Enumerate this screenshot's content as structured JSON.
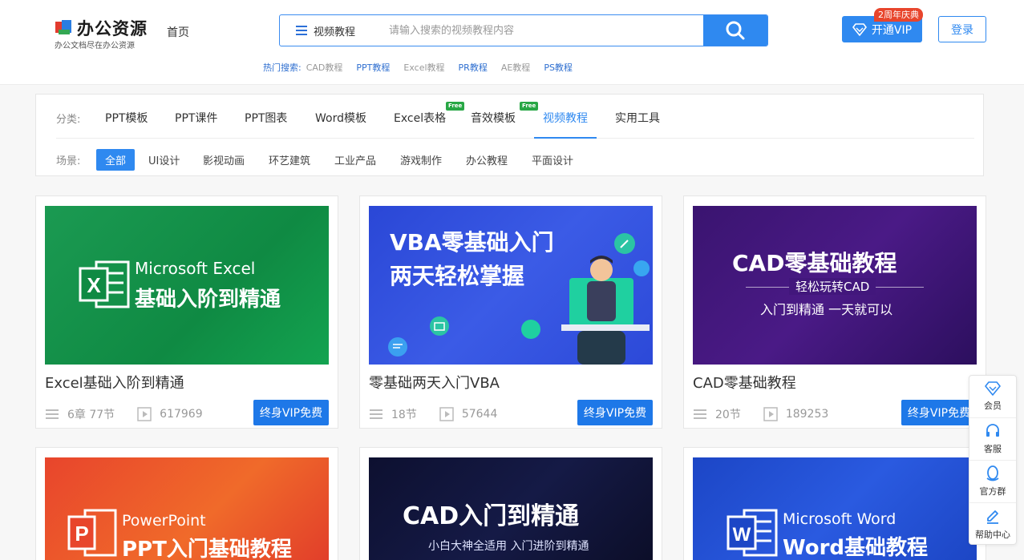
{
  "header": {
    "logo_title": "办公资源",
    "logo_subtitle": "办公文档尽在办公资源",
    "home_label": "首页",
    "search": {
      "category": "视频教程",
      "placeholder": "请输入搜索的视频教程内容"
    },
    "hot_label": "热门搜索:",
    "hot_items": [
      "CAD教程",
      "PPT教程",
      "Excel教程",
      "PR教程",
      "AE教程",
      "PS教程"
    ],
    "vip_label": "开通VIP",
    "vip_badge": "2周年庆典",
    "login_label": "登录"
  },
  "filter": {
    "category_label": "分类:",
    "categories": [
      "PPT模板",
      "PPT课件",
      "PPT图表",
      "Word模板",
      "Excel表格",
      "音效模板",
      "视频教程",
      "实用工具"
    ],
    "free_tag": "Free",
    "scene_label": "场景:",
    "scenes": [
      "全部",
      "UI设计",
      "影视动画",
      "环艺建筑",
      "工业产品",
      "游戏制作",
      "办公教程",
      "平面设计"
    ]
  },
  "cards": [
    {
      "title": "Excel基础入阶到精通",
      "chapters": "6章 77节",
      "views": "617969",
      "button": "终身VIP免费",
      "thumb": {
        "line1": "Microsoft Excel",
        "line2": "基础入阶到精通",
        "letter": "X"
      }
    },
    {
      "title": "零基础两天入门VBA",
      "chapters": "18节",
      "views": "57644",
      "button": "终身VIP免费",
      "thumb": {
        "line1": "VBA零基础入门",
        "line2": "两天轻松掌握"
      }
    },
    {
      "title": "CAD零基础教程",
      "chapters": "20节",
      "views": "189253",
      "button": "终身VIP免费",
      "thumb": {
        "line1": "CAD零基础教程",
        "line2": "轻松玩转CAD",
        "line3": "入门到精通 一天就可以"
      }
    },
    {
      "thumb": {
        "line1": "PowerPoint",
        "line2": "PPT入门基础教程",
        "letter": "P"
      }
    },
    {
      "thumb": {
        "line1": "CAD入门到精通",
        "line2": "小白大神全适用 入门进阶到精通"
      }
    },
    {
      "thumb": {
        "line1": "Microsoft Word",
        "line2": "Word基础教程",
        "letter": "W"
      }
    }
  ],
  "float_menu": [
    "会员",
    "客服",
    "官方群",
    "帮助中心"
  ],
  "colors": {
    "accent": "#2f89f0",
    "vip_badge": "#e8452c",
    "free_tag": "#28a745"
  }
}
